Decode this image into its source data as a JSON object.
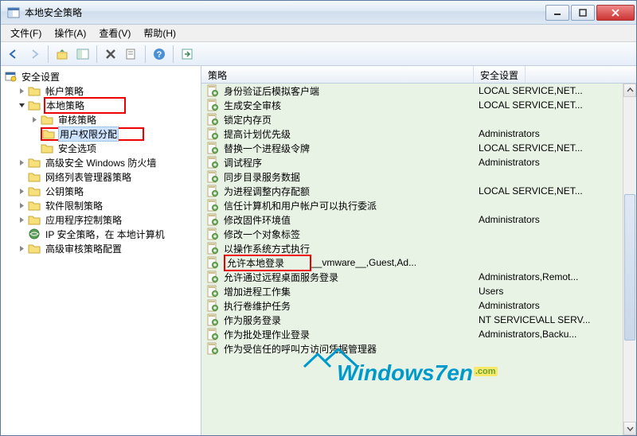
{
  "window": {
    "title": "本地安全策略"
  },
  "menu": {
    "file": "文件(F)",
    "action": "操作(A)",
    "view": "查看(V)",
    "help": "帮助(H)"
  },
  "tree": {
    "root": "安全设置",
    "accountPolicy": "帐户策略",
    "localPolicy": "本地策略",
    "auditPolicy": "审核策略",
    "userRights": "用户权限分配",
    "securityOptions": "安全选项",
    "firewall": "高级安全 Windows 防火墙",
    "networkList": "网络列表管理器策略",
    "publicKey": "公钥策略",
    "softwareRestriction": "软件限制策略",
    "appControl": "应用程序控制策略",
    "ipsec": "IP 安全策略，在 本地计算机",
    "advancedAudit": "高级审核策略配置"
  },
  "columns": {
    "policy": "策略",
    "setting": "安全设置"
  },
  "policies": [
    {
      "name": "身份验证后模拟客户端",
      "value": "LOCAL SERVICE,NET..."
    },
    {
      "name": "生成安全审核",
      "value": "LOCAL SERVICE,NET..."
    },
    {
      "name": "锁定内存页",
      "value": ""
    },
    {
      "name": "提高计划优先级",
      "value": "Administrators"
    },
    {
      "name": "替换一个进程级令牌",
      "value": "LOCAL SERVICE,NET..."
    },
    {
      "name": "调试程序",
      "value": "Administrators"
    },
    {
      "name": "同步目录服务数据",
      "value": ""
    },
    {
      "name": "为进程调整内存配额",
      "value": "LOCAL SERVICE,NET..."
    },
    {
      "name": "信任计算机和用户帐户可以执行委派",
      "value": ""
    },
    {
      "name": "修改固件环境值",
      "value": "Administrators"
    },
    {
      "name": "修改一个对象标签",
      "value": ""
    },
    {
      "name": "以操作系统方式执行",
      "value": ""
    },
    {
      "name": "允许本地登录",
      "value": "__vmware__,Guest,Ad...",
      "mark": true
    },
    {
      "name": "允许通过远程桌面服务登录",
      "value": "Administrators,Remot..."
    },
    {
      "name": "增加进程工作集",
      "value": "Users"
    },
    {
      "name": "执行卷维护任务",
      "value": "Administrators"
    },
    {
      "name": "作为服务登录",
      "value": "NT SERVICE\\ALL SERV..."
    },
    {
      "name": "作为批处理作业登录",
      "value": "Administrators,Backu..."
    },
    {
      "name": "作为受信任的呼叫方访问凭据管理器",
      "value": ""
    }
  ],
  "watermark": {
    "text": "Windows7en",
    "suffix": ".com"
  }
}
